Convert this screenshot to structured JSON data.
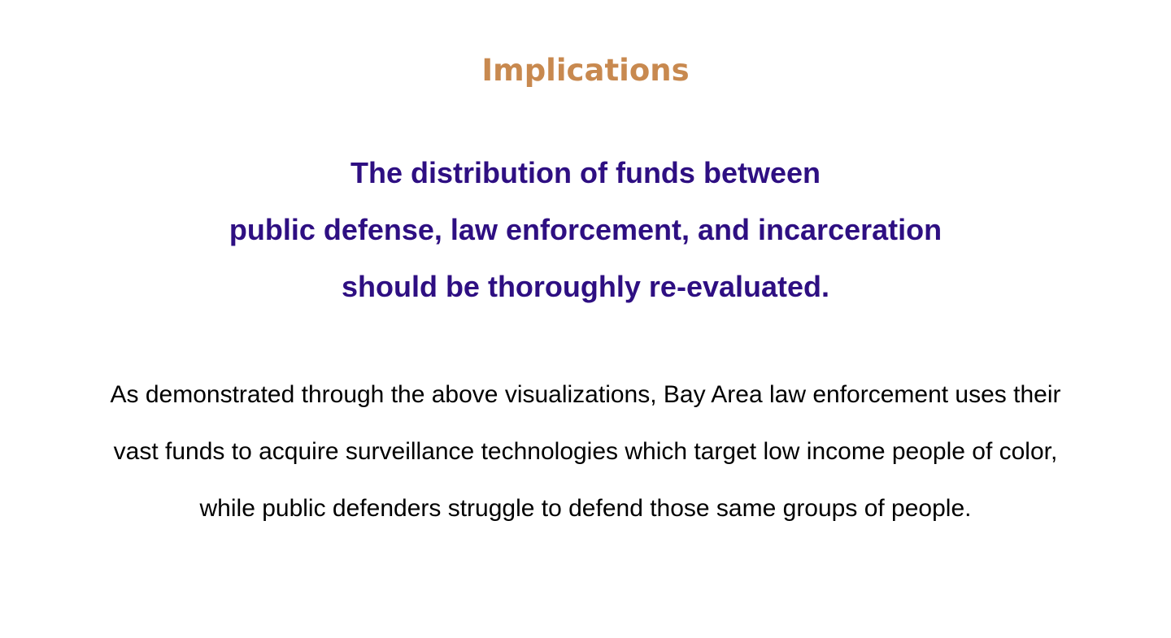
{
  "colors": {
    "heading": "#c8894f",
    "lede": "#2e0f82",
    "body": "#000000",
    "background": "#ffffff"
  },
  "implications": {
    "title": "Implications",
    "lede_lines": [
      "The distribution of funds between",
      "public defense, law enforcement, and incarceration",
      "should be thoroughly re-evaluated."
    ],
    "body_lines": [
      "As demonstrated through the above visualizations, Bay Area law enforcement uses their",
      "vast funds to acquire surveillance technologies which target low income people of color,",
      "while public defenders struggle to defend those same groups of people."
    ]
  }
}
